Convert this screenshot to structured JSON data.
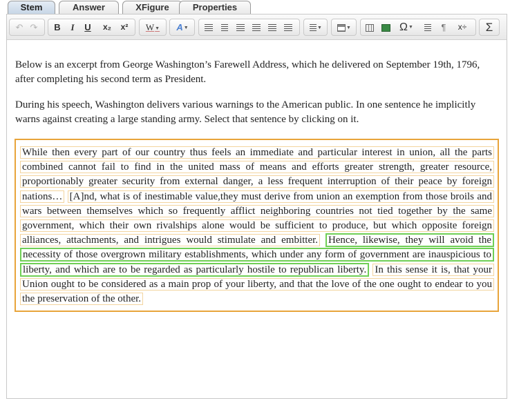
{
  "tabs": [
    {
      "label": "Stem",
      "active": true
    },
    {
      "label": "Answer",
      "active": false
    },
    {
      "label": "XFigure",
      "active": false
    },
    {
      "label": "Properties",
      "active": false
    }
  ],
  "toolbar": {
    "undo_icon": "undo-icon",
    "redo_icon": "redo-icon",
    "bold": "B",
    "italic": "I",
    "underline": "U",
    "subscript": "x₂",
    "superscript": "x²",
    "special_w": "W",
    "font_style": "A",
    "omega": "Ω",
    "sigma": "Σ",
    "pilcrow": "¶"
  },
  "intro": {
    "p1": "Below is an excerpt from George Washington’s Farewell Address, which he delivered on September 19th, 1796, after completing his second term as President.",
    "p2": "During his speech, Washington delivers various warnings to the American public. In one sentence he implicitly warns against creating a large standing army. Select that sentence by clicking on it."
  },
  "passage": {
    "sentences": [
      {
        "text": "While then every part of our country thus feels an immediate and particular interest in union, all the parts combined cannot fail to find in the united mass of means and efforts greater strength, greater resource, proportionably greater security from external danger, a less frequent interruption of their peace by foreign nations…",
        "selected": false
      },
      {
        "text": "[A]nd, what is of inestimable value,they must derive from union an exemption from those broils and wars between themselves which so frequently afflict neighboring countries not tied together by the same government, which their own rivalships alone would be sufficient to produce, but which opposite foreign alliances, attachments, and intrigues would stimulate and embitter.",
        "selected": false
      },
      {
        "text": "Hence, likewise, they will avoid the necessity of those overgrown military establishments, which under any form of government are inauspicious to liberty, and which are to be regarded as particularly hostile to republican liberty.",
        "selected": true
      },
      {
        "text": "In this sense it is, that your Union ought to be considered as a main prop of your liberty, and that the love of the one ought to endear to you the preservation of the other.",
        "selected": false
      }
    ]
  },
  "colors": {
    "passage_border": "#e8a43a",
    "sentence_border": "#f3d49e",
    "selected_border": "#6fcf55"
  }
}
